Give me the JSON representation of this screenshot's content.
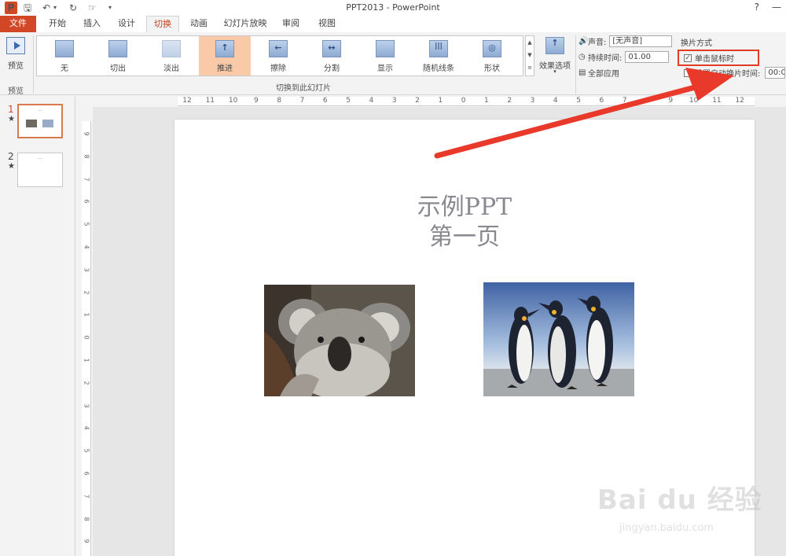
{
  "window": {
    "app_icon_letter": "P",
    "title": "PPT2013 - PowerPoint",
    "help": "?",
    "minimize": "—",
    "close": "✕"
  },
  "quick_access": {
    "save": "🖫",
    "undo": "↶",
    "undo_dropdown": "▾",
    "redo": "↻",
    "touch": "☞",
    "customize": "▾"
  },
  "tabs": [
    "文件",
    "开始",
    "插入",
    "设计",
    "切换",
    "动画",
    "幻灯片放映",
    "审阅",
    "视图"
  ],
  "ribbon": {
    "preview": {
      "label": "预览",
      "group_label": "预览"
    },
    "transitions": [
      {
        "label": "无",
        "icon": ""
      },
      {
        "label": "切出",
        "icon": ""
      },
      {
        "label": "淡出",
        "icon": ""
      },
      {
        "label": "推进",
        "icon": "↑"
      },
      {
        "label": "擦除",
        "icon": "←"
      },
      {
        "label": "分割",
        "icon": "↔"
      },
      {
        "label": "显示",
        "icon": ""
      },
      {
        "label": "随机线条",
        "icon": "|||"
      },
      {
        "label": "形状",
        "icon": "◎"
      }
    ],
    "gallery_scroll": {
      "up": "▲",
      "down": "▼",
      "more": "≡"
    },
    "gallery_group_label": "切换到此幻灯片",
    "effect_options": {
      "label": "效果选项",
      "arrow": "▾",
      "icon": "↑"
    },
    "timing": {
      "sound_icon": "🔊",
      "sound_label": "声音:",
      "sound_value": "[无声音]",
      "duration_icon": "◷",
      "duration_label": "持续时间:",
      "duration_value": "01.00",
      "apply_all_icon": "▤",
      "apply_all_label": "全部应用",
      "advance_heading": "换片方式",
      "on_click_label": "单击鼠标时",
      "on_click_checked": true,
      "after_label": "设置自动换片时间:",
      "after_checked": false,
      "after_value": "00:0"
    }
  },
  "slides": [
    {
      "number": "1",
      "star": "★"
    },
    {
      "number": "2",
      "star": "★"
    }
  ],
  "hruler_ticks": [
    "12",
    "11",
    "10",
    "9",
    "8",
    "7",
    "6",
    "5",
    "4",
    "3",
    "2",
    "1",
    "0",
    "1",
    "2",
    "3",
    "4",
    "5",
    "6",
    "7",
    "8",
    "9",
    "10",
    "11",
    "12"
  ],
  "vruler_ticks": [
    "9",
    "8",
    "7",
    "6",
    "5",
    "4",
    "3",
    "2",
    "1",
    "0",
    "1",
    "2",
    "3",
    "4",
    "5",
    "6",
    "7",
    "8",
    "9"
  ],
  "slide": {
    "title": "示例PPT",
    "subtitle": "第一页"
  },
  "watermark": {
    "main": "Bai du 经验",
    "sub": "jingyan.baidu.com"
  },
  "colors": {
    "accent": "#d24726",
    "annotation": "#e23c24",
    "selected_transition": "#f9c9a8"
  }
}
